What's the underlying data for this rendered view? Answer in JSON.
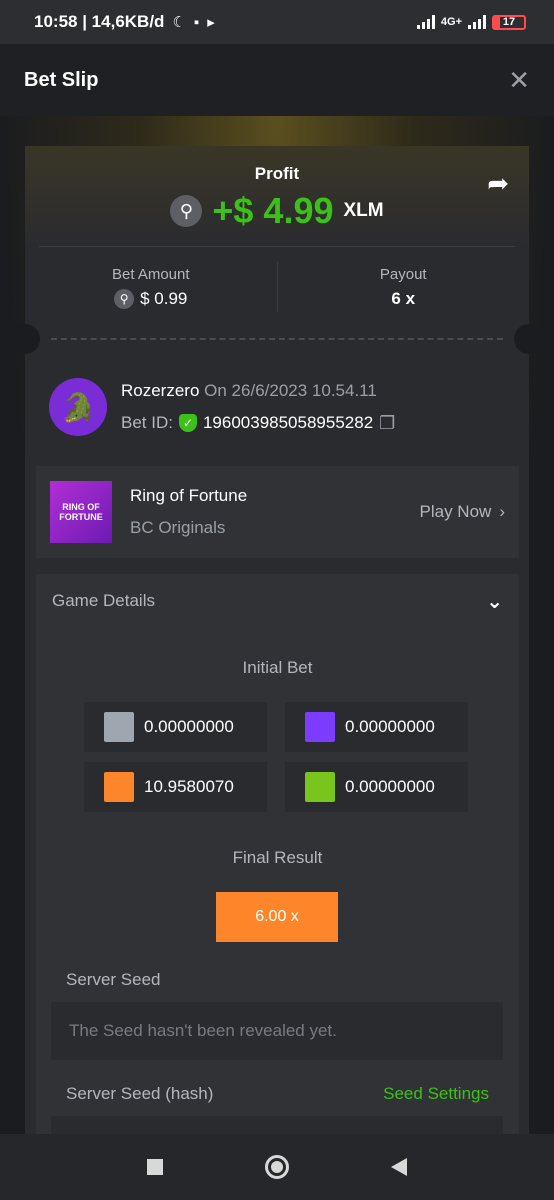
{
  "status_bar": {
    "time_speed": "10:58 | 14,6KB/d",
    "network": "4G+",
    "battery": "17"
  },
  "header": {
    "title": "Bet Slip"
  },
  "profit": {
    "label": "Profit",
    "value": "+$ 4.99",
    "currency": "XLM"
  },
  "bet": {
    "amount_label": "Bet Amount",
    "amount_value": "$ 0.99",
    "payout_label": "Payout",
    "payout_value": "6 x"
  },
  "user": {
    "name": "Rozerzero",
    "date": "On 26/6/2023 10.54.11",
    "bet_id_label": "Bet ID:",
    "bet_id": "196003985058955282"
  },
  "game": {
    "name": "Ring of Fortune",
    "provider": "BC Originals",
    "thumb_text": "RING OF FORTUNE",
    "play_label": "Play Now"
  },
  "details": {
    "title": "Game Details",
    "initial_bet_label": "Initial Bet",
    "bets": [
      {
        "color": "#9ea6b0",
        "value": "0.00000000"
      },
      {
        "color": "#7c3cff",
        "value": "0.00000000"
      },
      {
        "color": "#fd862b",
        "value": "10.9580070"
      },
      {
        "color": "#7ac51b",
        "value": "0.00000000"
      }
    ],
    "final_result_label": "Final Result",
    "final_result_value": "6.00 x",
    "server_seed_label": "Server Seed",
    "server_seed_value": "The Seed hasn't been revealed yet.",
    "server_seed_hash_label": "Server Seed (hash)",
    "seed_settings_label": "Seed Settings"
  },
  "colors": {
    "accent_green": "#3bc117",
    "result_orange": "#fd862b"
  }
}
